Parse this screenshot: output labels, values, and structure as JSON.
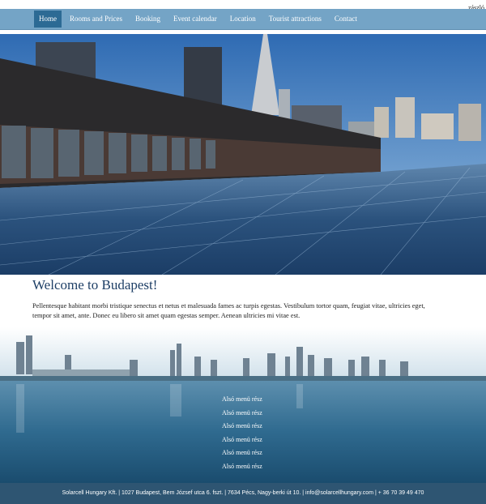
{
  "flag_label": "zászló",
  "nav": {
    "items": [
      {
        "label": "Home",
        "active": true
      },
      {
        "label": "Rooms and Prices",
        "active": false
      },
      {
        "label": "Booking",
        "active": false
      },
      {
        "label": "Event calendar",
        "active": false
      },
      {
        "label": "Location",
        "active": false
      },
      {
        "label": "Tourist attractions",
        "active": false
      },
      {
        "label": "Contact",
        "active": false
      }
    ]
  },
  "main": {
    "title": "Welcome to Budapest!",
    "body": "Pellentesque habitant morbi tristique senectus et netus et malesuada fames ac turpis egestas. Vestibulum tortor quam, feugiat vitae, ultricies eget, tempor sit amet, ante. Donec eu libero sit amet quam egestas semper. Aenean ultricies mi vitae est."
  },
  "lower_menu": {
    "items": [
      "Alsó menü rész",
      "Alsó menü rész",
      "Alsó menü rész",
      "Alsó menü rész",
      "Alsó menü rész",
      "Alsó menü rész"
    ]
  },
  "footer": {
    "text": "Solarcell Hungary Kft. | 1027 Budapest, Bem József utca 6. fszt. | 7634 Pécs, Nagy-berki út 10. | info@solarcellhungary.com | + 36 70 39 49 470"
  },
  "colors": {
    "nav_bg": "#74a4c6",
    "nav_active": "#2c6a94",
    "title": "#1e3f66",
    "footer_bg": "#2e5572"
  }
}
